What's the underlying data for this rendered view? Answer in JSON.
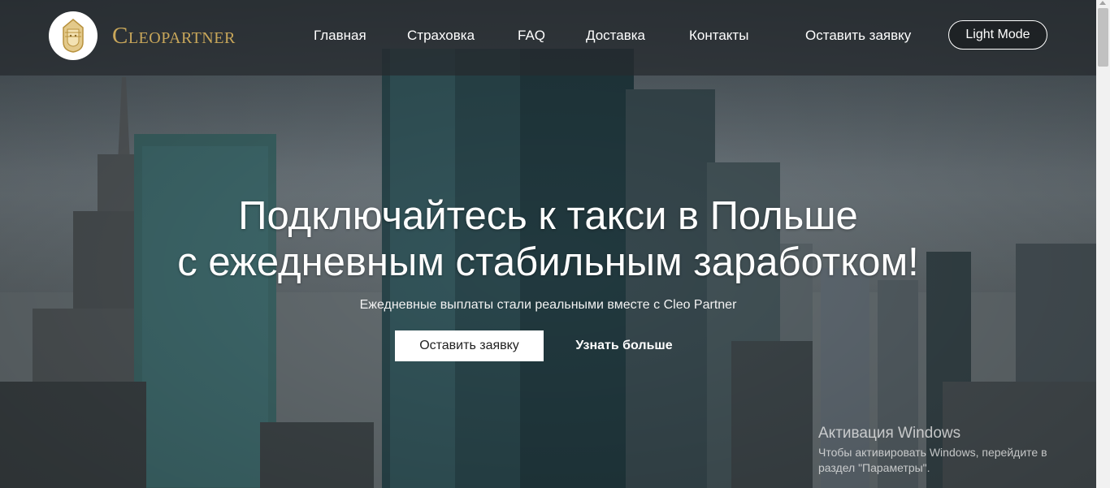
{
  "brand": {
    "name": "Cleopartner",
    "logo_icon": "pharaoh-icon"
  },
  "nav": {
    "items": [
      {
        "label": "Главная"
      },
      {
        "label": "Страховка"
      },
      {
        "label": "FAQ"
      },
      {
        "label": "Доставка"
      },
      {
        "label": "Контакты"
      },
      {
        "label": "Оставить заявку"
      }
    ],
    "mode_button": "Light Mode"
  },
  "hero": {
    "headline_line1": "Подключайтесь к такси в Польше",
    "headline_line2": "с ежедневным стабильным заработком!",
    "subheadline": "Ежедневные выплаты стали реальными вместе с Cleo Partner",
    "primary_button": "Оставить заявку",
    "secondary_button": "Узнать больше"
  },
  "watermark": {
    "title": "Активация Windows",
    "text": "Чтобы активировать Windows, перейдите в раздел \"Параметры\"."
  },
  "colors": {
    "brand_gold": "#c9a75a",
    "nav_background": "#262a2e",
    "button_background": "#ffffff"
  }
}
